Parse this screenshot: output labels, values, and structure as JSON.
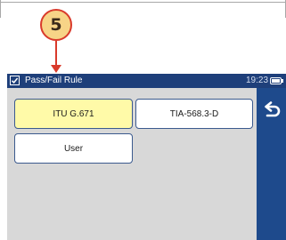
{
  "callout": {
    "step": "5"
  },
  "titlebar": {
    "title": "Pass/Fail Rule",
    "time": "19:23",
    "battery_level": 1.0
  },
  "rules": {
    "items": [
      {
        "label": "ITU G.671",
        "selected": true
      },
      {
        "label": "TIA-568.3-D",
        "selected": false
      },
      {
        "label": "User",
        "selected": false
      }
    ]
  },
  "sidebar": {
    "back_icon": "back-arrow-icon"
  },
  "colors": {
    "titlebar": "#1e3f7a",
    "sidebar": "#1e4a8c",
    "selected": "#fffaa8",
    "callout_border": "#d93a2b",
    "callout_fill": "#f7d487"
  }
}
